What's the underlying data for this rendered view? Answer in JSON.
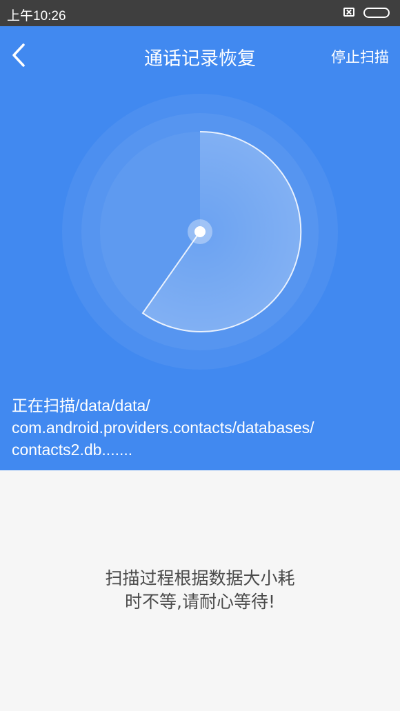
{
  "status_bar": {
    "time": "上午10:26",
    "icons": [
      "sim-disabled-icon",
      "battery-icon"
    ]
  },
  "header": {
    "back_icon": "chevron-left-icon",
    "title": "通话记录恢复",
    "stop_label": "停止扫描"
  },
  "scan": {
    "path_lines": [
      "正在扫描/data/data/",
      "com.android.providers.contacts/databases/",
      "contacts2.db......."
    ]
  },
  "hint": {
    "lines": [
      "扫描过程根据数据大小耗",
      "时不等,请耐心等待!"
    ]
  },
  "colors": {
    "header_bg": "#4189f0",
    "status_bar_bg": "#3f3f3f",
    "body_bg": "#f6f6f6",
    "hint_text": "#4a4a4a"
  }
}
